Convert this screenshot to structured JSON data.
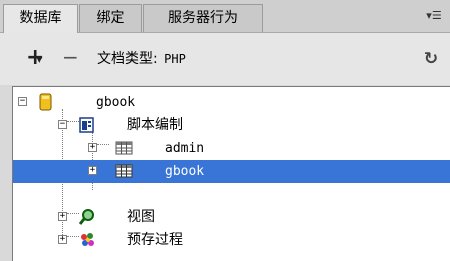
{
  "tabs": [
    {
      "label": "数据库",
      "active": true
    },
    {
      "label": "绑定",
      "active": false
    },
    {
      "label": "服务器行为",
      "active": false
    }
  ],
  "panel_menu_icon": "panel-options-icon",
  "toolbar": {
    "add_icon": "plus-icon",
    "remove_icon": "minus-icon",
    "doctype_label": "文档类型:",
    "doctype_value": "PHP",
    "refresh_icon": "refresh-icon"
  },
  "tree": {
    "root": {
      "label": "gbook",
      "icon": "database-icon",
      "expanded": true
    },
    "scripts": {
      "label": "脚本编制",
      "icon": "script-icon",
      "expanded": true
    },
    "tables": [
      {
        "label": "admin",
        "icon": "table-icon",
        "selected": false
      },
      {
        "label": "gbook",
        "icon": "table-icon",
        "selected": true
      }
    ],
    "views": {
      "label": "视图",
      "icon": "view-icon"
    },
    "procedures": {
      "label": "预存过程",
      "icon": "procedure-icon"
    }
  },
  "colors": {
    "selection": "#3875d7",
    "panel_bg": "#e6e6e6"
  }
}
